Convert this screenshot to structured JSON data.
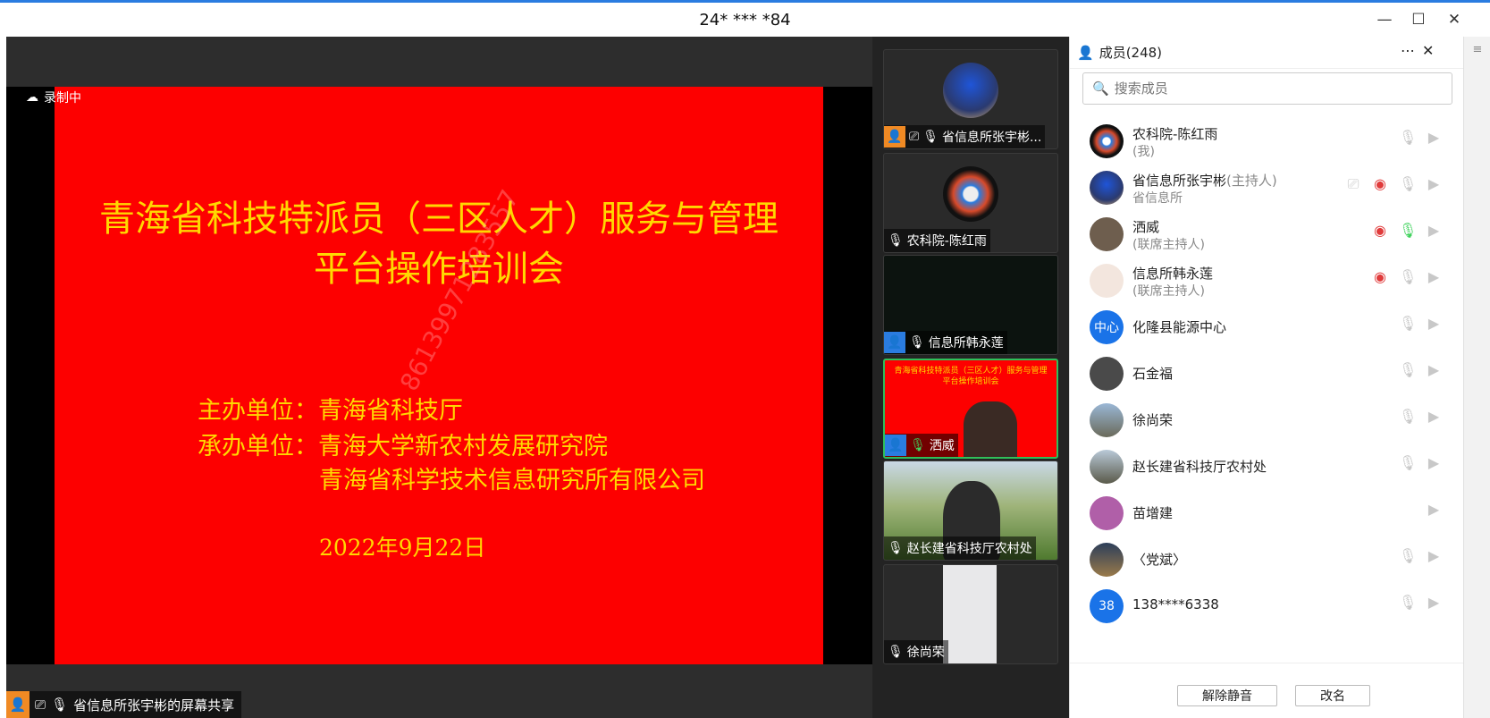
{
  "window": {
    "title": "24* *** *84"
  },
  "share": {
    "recording": "录制中",
    "presenter_label": "省信息所张宇彬的屏幕共享",
    "slide": {
      "title_line1": "青海省科技特派员（三区人才）服务与管理",
      "title_line2": "平台操作培训会",
      "host_label": "主办单位：青海省科技厅",
      "organizer_label": "承办单位：青海大学新农村发展研究院",
      "organizer2": "青海省科学技术信息研究所有限公司",
      "date": "2022年9月22日",
      "watermark": "86139971283557"
    }
  },
  "thumbnails": [
    {
      "name": "省信息所张宇彬..."
    },
    {
      "name": "农科院-陈红雨"
    },
    {
      "name": "信息所韩永莲"
    },
    {
      "name": "洒威"
    },
    {
      "name": "赵长建省科技厅农村处"
    },
    {
      "name": "徐尚荣"
    }
  ],
  "members": {
    "title": "成员(248)",
    "search_placeholder": "搜索成员",
    "items": [
      {
        "name": "农科院-陈红雨",
        "sub": "(我)",
        "avatar": ""
      },
      {
        "name": "省信息所张宇彬",
        "tag": "(主持人)",
        "sub": "省信息所",
        "avatar": ""
      },
      {
        "name": "洒威",
        "sub": "(联席主持人)",
        "avatar": ""
      },
      {
        "name": "信息所韩永莲",
        "sub": "(联席主持人)",
        "avatar": ""
      },
      {
        "name": "化隆县能源中心",
        "avatar": "中心"
      },
      {
        "name": "石金福",
        "avatar": ""
      },
      {
        "name": "徐尚荣",
        "avatar": ""
      },
      {
        "name": "赵长建省科技厅农村处",
        "avatar": ""
      },
      {
        "name": "苗增建",
        "avatar": ""
      },
      {
        "name": "〈党斌〉",
        "avatar": ""
      },
      {
        "name": "138****6338",
        "avatar": "38"
      }
    ],
    "unmute_label": "解除静音",
    "rename_label": "改名"
  }
}
